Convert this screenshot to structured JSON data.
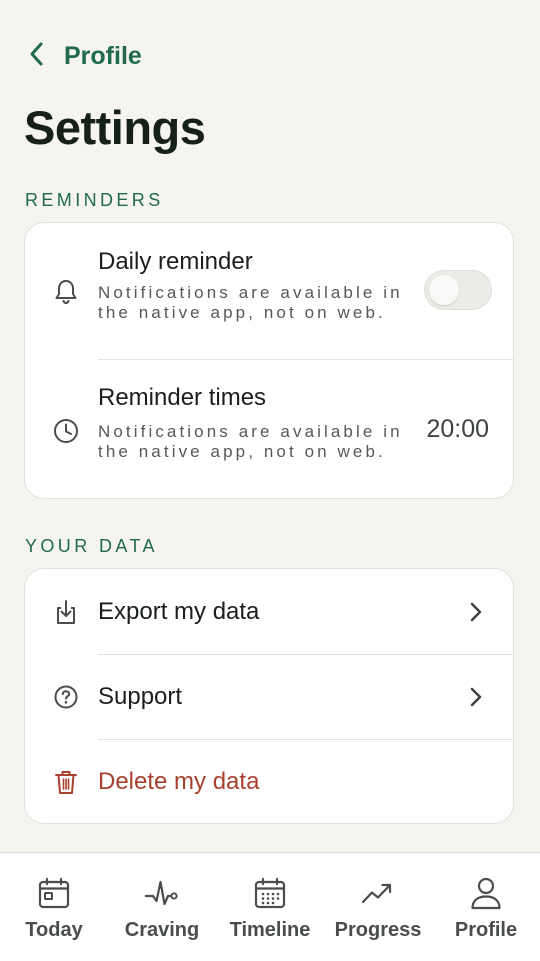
{
  "header": {
    "back_label": "Profile",
    "title": "Settings"
  },
  "reminders": {
    "section_label": "REMINDERS",
    "daily": {
      "title": "Daily reminder",
      "subtitle": "Notifications are available in the native app, not on web.",
      "toggle_on": false,
      "icon": "bell-icon"
    },
    "times": {
      "title": "Reminder times",
      "subtitle": "Notifications are available in the native app, not on web.",
      "value": "20:00",
      "icon": "clock-icon"
    }
  },
  "data_section": {
    "section_label": "YOUR DATA",
    "items": [
      {
        "label": "Export my data",
        "icon": "download-icon"
      },
      {
        "label": "Support",
        "icon": "help-circle-icon"
      },
      {
        "label": "Delete my data",
        "icon": "trash-icon",
        "color": "#a8412e"
      }
    ]
  },
  "tabs": [
    {
      "label": "Today",
      "icon": "calendar-today-icon"
    },
    {
      "label": "Craving",
      "icon": "activity-pulse-icon"
    },
    {
      "label": "Timeline",
      "icon": "calendar-grid-icon"
    },
    {
      "label": "Progress",
      "icon": "trending-up-icon"
    },
    {
      "label": "Profile",
      "icon": "user-icon"
    }
  ],
  "colors": {
    "accent": "#1f6b4c",
    "danger": "#a8412e",
    "background": "#f5f4ef"
  }
}
